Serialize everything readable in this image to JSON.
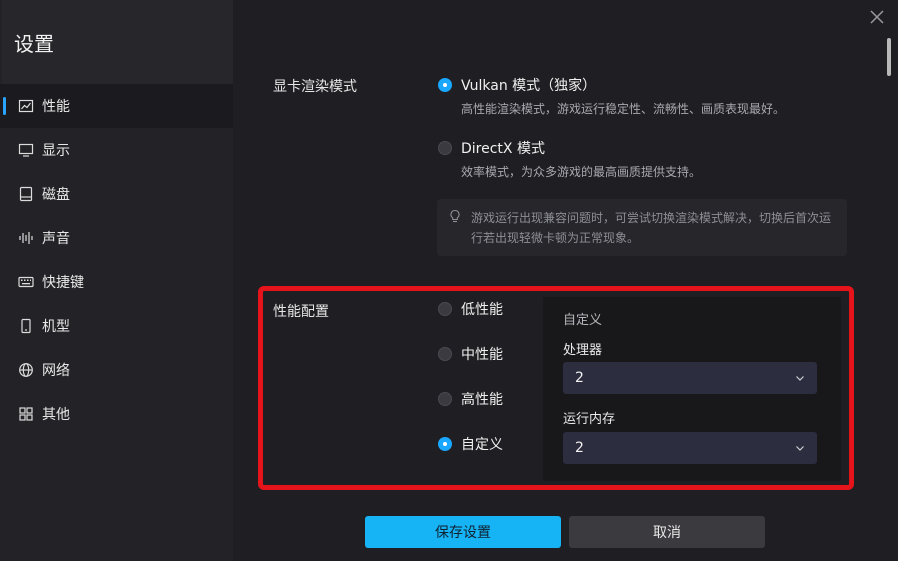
{
  "sidebar": {
    "title": "设置",
    "items": [
      {
        "label": "性能",
        "icon": "chart-icon",
        "active": true
      },
      {
        "label": "显示",
        "icon": "monitor-icon"
      },
      {
        "label": "磁盘",
        "icon": "disk-icon"
      },
      {
        "label": "声音",
        "icon": "sound-wave-icon"
      },
      {
        "label": "快捷键",
        "icon": "keyboard-icon"
      },
      {
        "label": "机型",
        "icon": "phone-icon"
      },
      {
        "label": "网络",
        "icon": "globe-icon"
      },
      {
        "label": "其他",
        "icon": "grid-icon"
      }
    ]
  },
  "render_mode": {
    "label": "显卡渲染模式",
    "options": [
      {
        "label": "Vulkan 模式（独家）",
        "desc": "高性能渲染模式，游戏运行稳定性、流畅性、画质表现最好。",
        "checked": true
      },
      {
        "label": "DirectX 模式",
        "desc": "效率模式，为众多游戏的最高画质提供支持。",
        "checked": false
      }
    ],
    "tip_line1": "游戏运行出现兼容问题时，可尝试切换渲染模式解决，切换后首次运",
    "tip_line2": "行若出现轻微卡顿为正常现象。"
  },
  "performance": {
    "label": "性能配置",
    "options": [
      {
        "label": "低性能",
        "checked": false
      },
      {
        "label": "中性能",
        "checked": false
      },
      {
        "label": "高性能",
        "checked": false
      },
      {
        "label": "自定义",
        "checked": true
      }
    ],
    "custom": {
      "title": "自定义",
      "cpu_label": "处理器",
      "cpu_value": "2",
      "memory_label": "运行内存",
      "memory_value": "2"
    }
  },
  "buttons": {
    "save": "保存设置",
    "cancel": "取消"
  },
  "colors": {
    "accent": "#1aa7ff",
    "highlight_frame": "#e5141b"
  }
}
